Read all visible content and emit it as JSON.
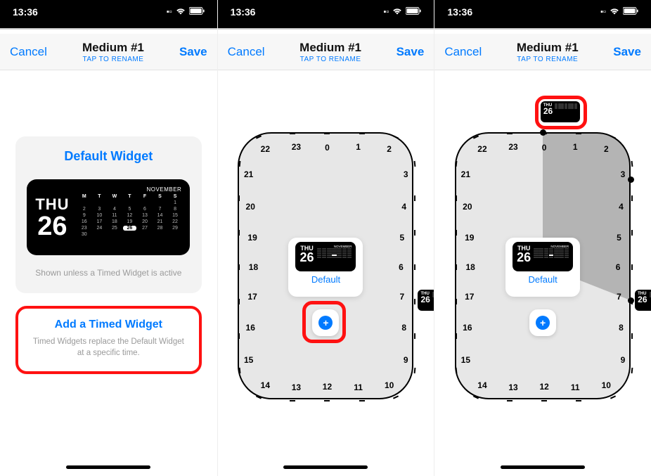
{
  "status": {
    "time": "13:36"
  },
  "nav": {
    "cancel": "Cancel",
    "title": "Medium #1",
    "subtitle": "TAP TO RENAME",
    "save": "Save"
  },
  "colors": {
    "accent": "#007aff",
    "highlight": "#f11"
  },
  "calendar": {
    "dow": "THU",
    "daynum": "26",
    "month": "NOVEMBER",
    "headers": [
      "M",
      "T",
      "W",
      "T",
      "F",
      "S",
      "S"
    ],
    "weeks": [
      [
        "",
        "",
        "",
        "",
        "",
        "",
        "1"
      ],
      [
        "2",
        "3",
        "4",
        "5",
        "6",
        "7",
        "8"
      ],
      [
        "9",
        "10",
        "11",
        "12",
        "13",
        "14",
        "15"
      ],
      [
        "16",
        "17",
        "18",
        "19",
        "20",
        "21",
        "22"
      ],
      [
        "23",
        "24",
        "25",
        "26",
        "27",
        "28",
        "29"
      ],
      [
        "30",
        "",
        "",
        "",
        "",
        "",
        ""
      ]
    ],
    "today": "26"
  },
  "screen1": {
    "default_title": "Default Widget",
    "default_caption": "Shown unless a Timed Widget is active",
    "add_title": "Add a Timed Widget",
    "add_caption": "Timed Widgets replace the Default Widget at a specific time."
  },
  "dial": {
    "mini_label": "Default",
    "hours": [
      "0",
      "1",
      "2",
      "3",
      "4",
      "5",
      "6",
      "7",
      "8",
      "9",
      "10",
      "11",
      "12",
      "13",
      "14",
      "15",
      "16",
      "17",
      "18",
      "19",
      "20",
      "21",
      "22",
      "23"
    ]
  },
  "screen2": {
    "thumb_hour": 7,
    "highlight_plus": true
  },
  "screen3": {
    "thumb_side_hour": 7,
    "thumb_top_between": [
      0,
      1
    ],
    "wedge": {
      "from_hour": 0,
      "to_hour": 7
    },
    "highlight_top_thumb": true
  }
}
